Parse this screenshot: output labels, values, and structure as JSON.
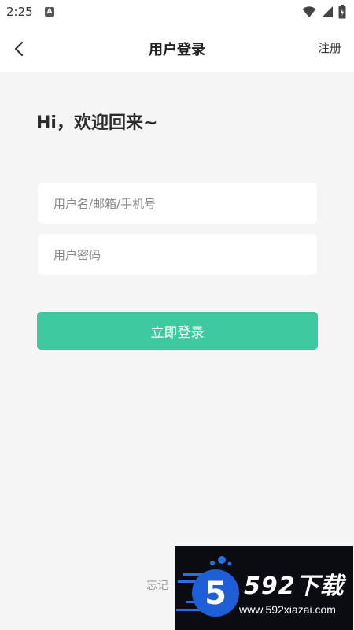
{
  "status_bar": {
    "time": "2:25",
    "notification_letter": "A"
  },
  "header": {
    "title": "用户登录",
    "register_label": "注册"
  },
  "greeting": "Hi，欢迎回来~",
  "form": {
    "username": {
      "value": "",
      "placeholder": "用户名/邮箱/手机号"
    },
    "password": {
      "value": "",
      "placeholder": "用户密码"
    },
    "login_label": "立即登录"
  },
  "forgot_label": "忘记",
  "watermark": {
    "brand": "592下载",
    "site": "www.592xiazai.com"
  },
  "colors": {
    "accent": "#3ec99e",
    "background": "#f5f5f5",
    "watermark_bg": "#0b0b12",
    "watermark_blue": "#2a6fe0"
  },
  "icons": {
    "back": "chevron-left-icon",
    "wifi": "wifi-icon",
    "signal": "signal-icon",
    "battery": "battery-icon"
  }
}
